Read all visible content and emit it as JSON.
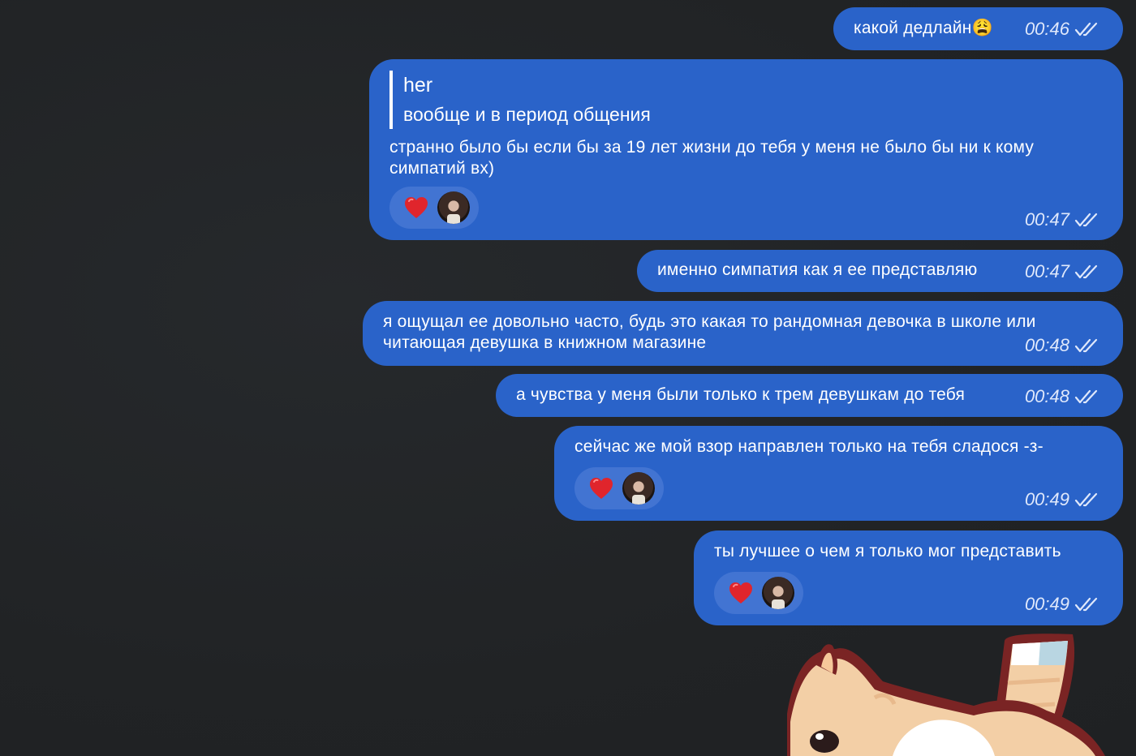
{
  "messages": [
    {
      "text": "какой дедлайн😩",
      "time": "00:46"
    },
    {
      "reply_author": "her",
      "reply_text": "вообще и в период общения",
      "text": "странно было бы если бы за 19 лет жизни до тебя у меня не было бы ни к кому\nсимпатий вх)",
      "reaction": "❤️",
      "time": "00:47"
    },
    {
      "text": "именно симпатия как я ее представляю",
      "time": "00:47"
    },
    {
      "text": "я ощущал ее довольно часто, будь это какая то рандомная девочка в школе или\nчитающая девушка в книжном магазине",
      "time": "00:48"
    },
    {
      "text": "а чувства у меня были только к трем девушкам до тебя",
      "time": "00:48"
    },
    {
      "text": "сейчас же мой взор направлен только на тебя сладося -з-",
      "reaction": "❤️",
      "time": "00:49"
    },
    {
      "text": "ты лучшее о чем я только мог представить",
      "reaction": "❤️",
      "time": "00:49"
    }
  ],
  "colors": {
    "background": "#212325",
    "bubble": "#2a63c9",
    "reaction_pill": "#4274d2"
  },
  "icons": {
    "read_status": "double-check-icon",
    "reaction": "heart-icon",
    "sticker": "cat-sticker"
  }
}
